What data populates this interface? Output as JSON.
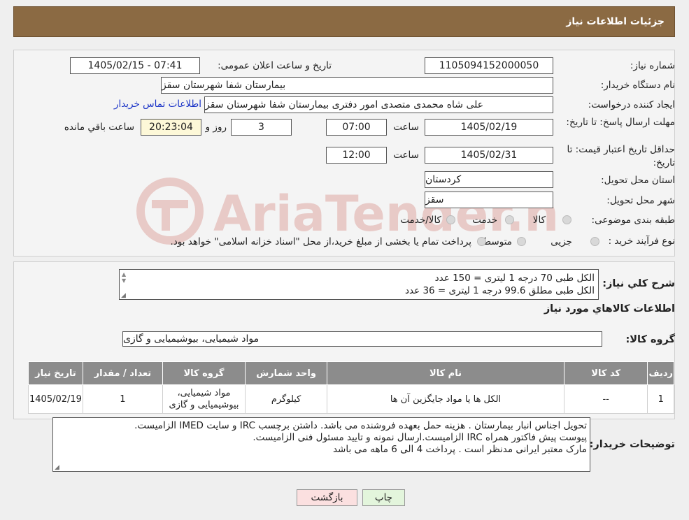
{
  "header": {
    "title": "جزئیات اطلاعات نیاز"
  },
  "fields": {
    "need_number_label": "شماره نیاز:",
    "need_number": "1105094152000050",
    "announce_label": "تاریخ و ساعت اعلان عمومی:",
    "announce_value": "1405/02/15 - 07:41",
    "buyer_org_label": "نام دستگاه خریدار:",
    "buyer_org": "بیمارستان شفا شهرستان سقز",
    "creator_label": "ایجاد کننده درخواست:",
    "creator": "علی شاه محمدی متصدی امور دفتری بیمارستان شفا شهرستان سقز",
    "contact_link": "اطلاعات تماس خریدار",
    "deadline_label": "مهلت ارسال پاسخ: تا تاریخ:",
    "deadline_date": "1405/02/19",
    "time_label": "ساعت",
    "deadline_time": "07:00",
    "days_value": "3",
    "days_label": "روز و",
    "remaining_time": "20:23:04",
    "remaining_label": "ساعت باقي مانده",
    "validity_label": "حداقل تاریخ اعتبار قیمت: تا تاریخ:",
    "validity_date": "1405/02/31",
    "validity_time": "12:00",
    "province_label": "استان محل تحویل:",
    "province": "کردستان",
    "city_label": "شهر محل تحویل:",
    "city": "سقز",
    "category_label": "طبقه بندی موضوعی:",
    "cat_goods": "کالا",
    "cat_service": "خدمت",
    "cat_both": "کالا/خدمت",
    "process_label": "نوع فرآیند خرید :",
    "proc_partial": "جزیی",
    "proc_medium": "متوسط",
    "payment_note": "پرداخت تمام یا بخشی از مبلغ خرید،از محل \"اسناد خزانه اسلامی\" خواهد بود."
  },
  "summary": {
    "label": "شرح کلي نياز:",
    "line1": "الکل طبی 70 درجه 1 لیتری = 150 عدد",
    "line2": "الکل طبی مطلق 99.6 درجه 1 لیتری = 36 عدد",
    "goods_info_title": "اطلاعات کالاهاي مورد نياز",
    "group_label": "گروه کالا:",
    "group_value": "مواد شیمیایی، بیوشیمیایی و  گازی"
  },
  "table": {
    "headers": [
      "رديف",
      "کد کالا",
      "نام کالا",
      "واحد شمارش",
      "گروه کالا",
      "تعداد / مقدار",
      "تاريخ نياز"
    ],
    "rows": [
      {
        "row": "1",
        "code": "--",
        "name": "الکل ها یا مواد جایگزین آن ها",
        "unit": "کیلوگرم",
        "group1": "مواد شیمیایی،",
        "group2": "بیوشیمیایی و گازی",
        "qty": "1",
        "date": "1405/02/19"
      }
    ]
  },
  "notes": {
    "label": "توضیحات خریدار:",
    "line1": "تحویل اجناس  انبار بیمارستان . هزینه حمل بعهده فروشنده می باشد.  داشتن برچسب IRC  و سایت  IMED  الزامیست.",
    "line2": "پیوست پیش فاکتور همراه IRC  الزامیست.ارسال نمونه و تایید مسئول فنی الزامیست.",
    "line3": "مارک معتبر ایرانی مدنظر است . پرداخت 4 الی 6 ماهه می باشد"
  },
  "buttons": {
    "print": "چاپ",
    "back": "بازگشت"
  },
  "watermark": {
    "text": "AriaTender.neT"
  },
  "colors": {
    "header_bg": "#8b6a43",
    "link": "#1a33c7",
    "remaining_bg": "#fdf8d8",
    "print_bg": "#e3f5dc",
    "back_bg": "#fbe0e0",
    "table_header": "#8c8c8c"
  }
}
